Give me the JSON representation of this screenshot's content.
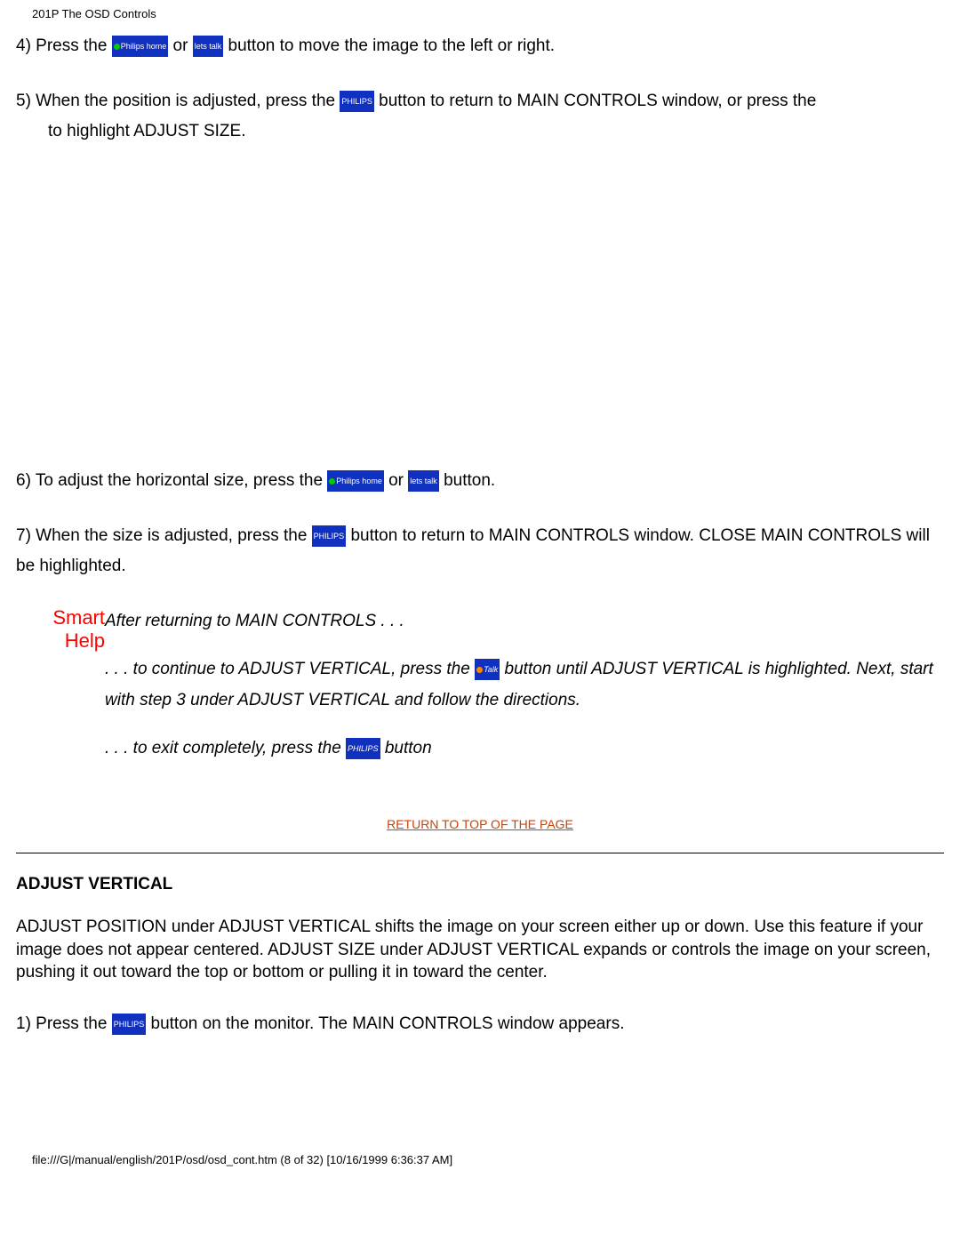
{
  "header": "201P The OSD Controls",
  "step4": {
    "a": "4) Press the ",
    "or": " or ",
    "b": " button to move the image to the left or right."
  },
  "step5": {
    "a": "5) When the position is adjusted, press the ",
    "b": " button to return to MAIN CONTROLS window, or press the",
    "c": "to highlight ADJUST SIZE."
  },
  "step6": {
    "a": "6) To adjust the horizontal size, press the ",
    "or": " or ",
    "b": " button."
  },
  "step7": {
    "a": "7) When the size is adjusted, press the ",
    "b": " button to return to MAIN CONTROLS window. CLOSE MAIN CONTROLS will be highlighted."
  },
  "smarthelp": {
    "label": "Smart Help",
    "p1": "After returning to MAIN CONTROLS . . .",
    "p2a": ". . . to continue to ADJUST VERTICAL, press the ",
    "p2b": " button until ADJUST VERTICAL is highlighted. Next, start with step 3 under ADJUST VERTICAL and follow the directions.",
    "p3a": ". . . to exit completely, press the ",
    "p3b": " button"
  },
  "toplink": "RETURN TO TOP OF THE PAGE",
  "section": {
    "heading": "ADJUST VERTICAL",
    "body": "ADJUST POSITION under ADJUST VERTICAL shifts the image on your screen either up or down. Use this feature if your image does not appear centered. ADJUST SIZE under ADJUST VERTICAL expands or controls the image on your screen, pushing it out toward the top or bottom or pulling it in toward the center."
  },
  "step1": {
    "a": "1) Press the ",
    "b": " button on the monitor. The MAIN CONTROLS window appears."
  },
  "footer": "file:///G|/manual/english/201P/osd/osd_cont.htm (8 of 32) [10/16/1999 6:36:37 AM]",
  "icons": {
    "philips_home": "Philips home",
    "philips": "PHILIPS",
    "talk": "Talk",
    "scramble": "lets talk"
  }
}
